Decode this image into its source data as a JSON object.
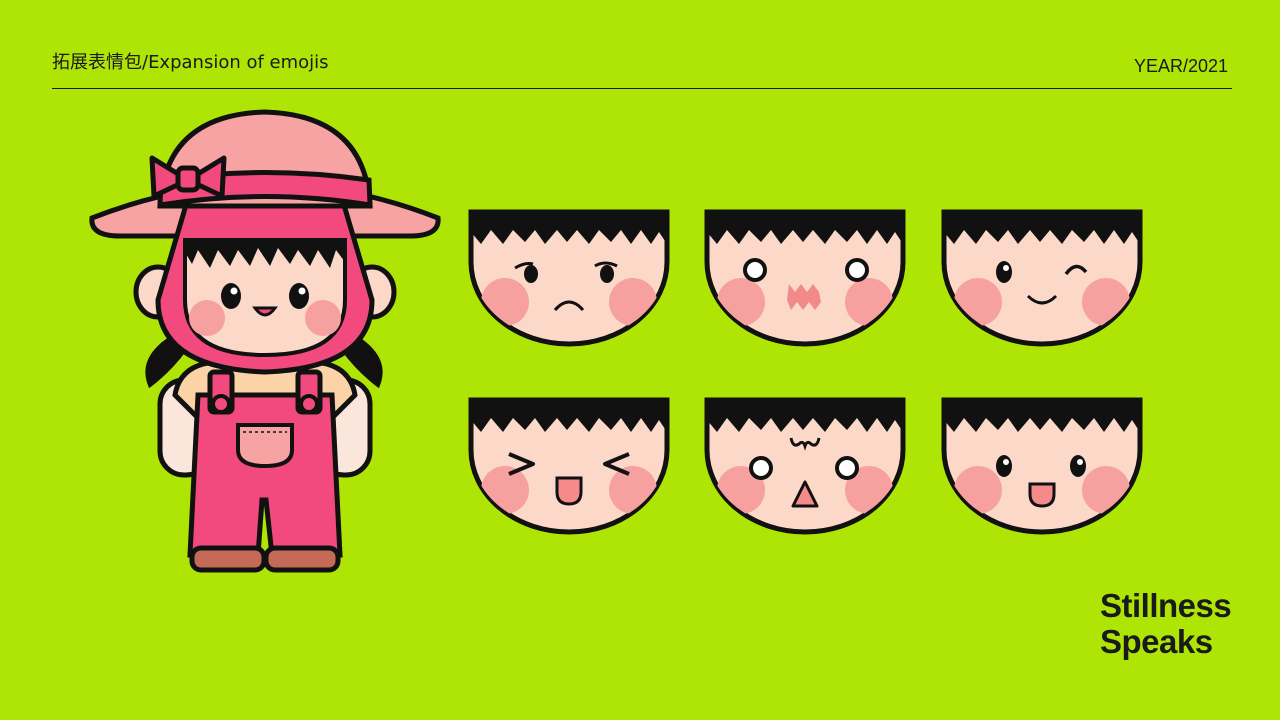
{
  "header": {
    "title": "拓展表情包/Expansion of emojis",
    "year": "YEAR/2021"
  },
  "brand": {
    "line1": "Stillness",
    "line2": "Speaks"
  },
  "colors": {
    "background": "#afe505",
    "hat_pink": "#f7a3a3",
    "overall_pink": "#f24a7e",
    "skin": "#fbd8c8",
    "blush": "#f7a0a0",
    "hair": "#111111",
    "shoes": "#c46a57"
  },
  "character": {
    "icon": "girl-with-sun-hat-and-overalls"
  },
  "emojis": [
    {
      "expression": "skeptical"
    },
    {
      "expression": "surprised-wavy-mouth"
    },
    {
      "expression": "wink-smile"
    },
    {
      "expression": "squinting-laugh"
    },
    {
      "expression": "shocked"
    },
    {
      "expression": "happy"
    }
  ]
}
